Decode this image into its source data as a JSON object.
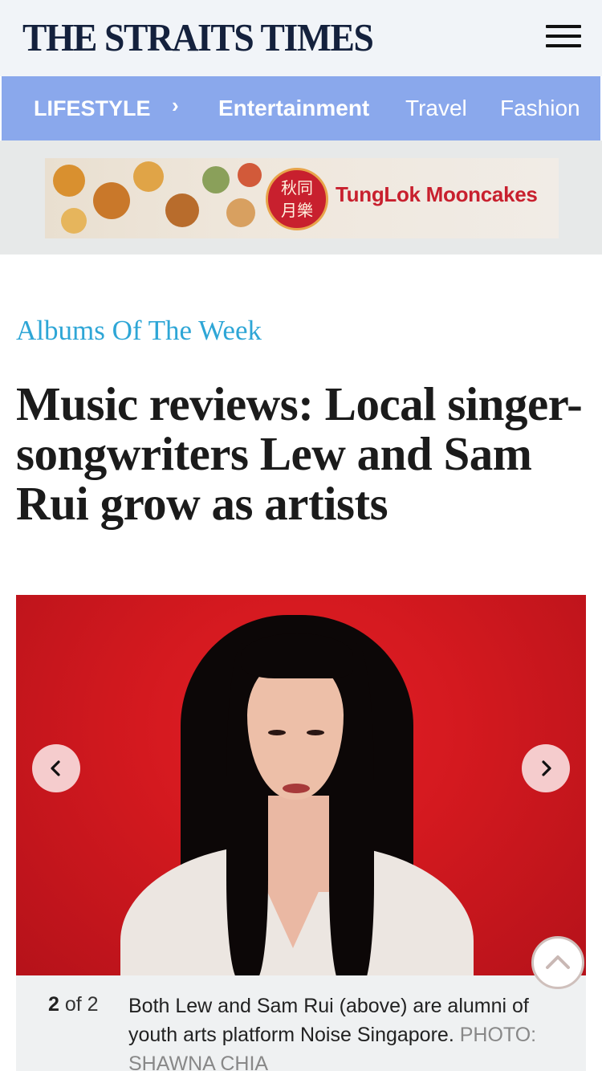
{
  "header": {
    "logo_text": "THE STRAITS TIMES",
    "menu_icon": "hamburger-menu-icon"
  },
  "nav": {
    "section": "LIFESTYLE",
    "separator_icon": "chevron-right-icon",
    "items": [
      "Entertainment",
      "Travel",
      "Fashion"
    ],
    "color": "#8aa8ec"
  },
  "ad": {
    "seal_text": "秋同月樂",
    "brand": "TungLok Mooncakes"
  },
  "article": {
    "kicker": "Albums Of The Week",
    "headline": "Music reviews: Local singer-songwriters Lew and Sam Rui grow as artists",
    "kicker_color": "#2ea6d6"
  },
  "gallery": {
    "current": "2",
    "of_label": "of 2",
    "caption": "Both Lew and Sam Rui (above) are alumni of youth arts platform Noise Singapore.",
    "credit": "PHOTO: SHAWNA CHIA",
    "prev_icon": "chevron-left-icon",
    "next_icon": "chevron-right-icon",
    "scroll_top_icon": "chevron-up-icon"
  }
}
